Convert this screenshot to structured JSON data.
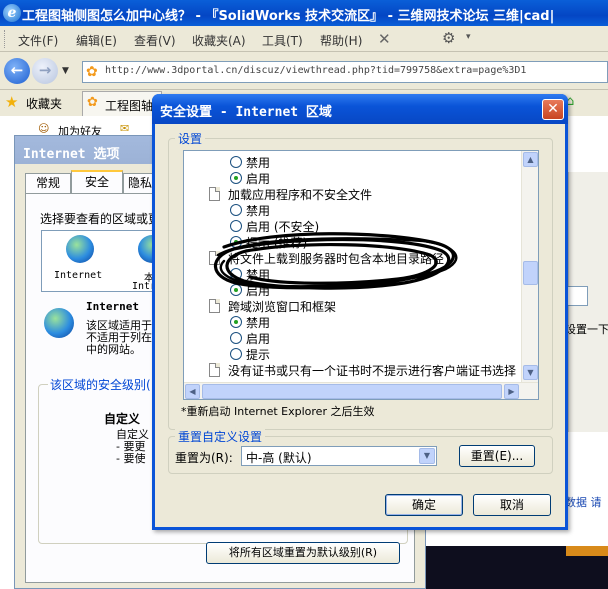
{
  "ie_window": {
    "title": "工程图轴侧图怎么加中心线？ - 『SolidWorks 技术交流区』 - 三维网技术论坛 三维|cad|",
    "menu": [
      "文件(F)",
      "编辑(E)",
      "查看(V)",
      "收藏夹(A)",
      "工具(T)",
      "帮助(H)"
    ],
    "address_url": "http://www.3dportal.cn/discuz/viewthread.php?tid=799758&extra=page%3D1",
    "favorites_label": "收藏夹",
    "tab_label": "工程图轴",
    "page_behind_text": {
      "add_friend": "加为好友",
      "right_text_1": "设置一下",
      "right_text_2": "数据 请"
    }
  },
  "internet_options": {
    "title": "Internet 选项",
    "tabs": [
      "常规",
      "安全",
      "隐私"
    ],
    "zone_prompt": "选择要查看的区域或更",
    "zones": [
      {
        "label": "Internet",
        "icon": "globe-icon"
      },
      {
        "label": "本",
        "icon": "globe-icon"
      }
    ],
    "zones_extra_label": "Intr",
    "zone_heading": "Internet",
    "zone_desc": [
      "该区域适用于",
      "不适用于列在",
      "中的网站。"
    ],
    "security_level_label": "该区域的安全级别(",
    "custom_label": "自定义",
    "custom_lines": [
      "自定义",
      "- 要更",
      "- 要使"
    ],
    "reset_all_button": "将所有区域重置为默认级别(R)"
  },
  "security_dialog": {
    "title": "安全设置 - Internet 区域",
    "close_glyph": "✕",
    "settings_group_label": "设置",
    "settings_items": [
      {
        "kind": "radio",
        "label": "禁用",
        "checked": false
      },
      {
        "kind": "radio",
        "label": "启用",
        "checked": true
      },
      {
        "kind": "header",
        "label": "加载应用程序和不安全文件"
      },
      {
        "kind": "radio",
        "label": "禁用",
        "checked": false
      },
      {
        "kind": "radio",
        "label": "启用 (不安全)",
        "checked": false
      },
      {
        "kind": "radio",
        "label": "提示 (推荐)",
        "checked": true
      },
      {
        "kind": "header",
        "label": "将文件上载到服务器时包含本地目录路径"
      },
      {
        "kind": "radio",
        "label": "禁用",
        "checked": false
      },
      {
        "kind": "radio",
        "label": "启用",
        "checked": true
      },
      {
        "kind": "header",
        "label": "跨域浏览窗口和框架"
      },
      {
        "kind": "radio",
        "label": "禁用",
        "checked": true
      },
      {
        "kind": "radio",
        "label": "启用",
        "checked": false
      },
      {
        "kind": "radio",
        "label": "提示",
        "checked": false
      },
      {
        "kind": "header",
        "label": "没有证书或只有一个证书时不提示进行客户端证书选择"
      }
    ],
    "restart_note": "*重新启动 Internet Explorer 之后生效",
    "reset_group_label": "重置自定义设置",
    "reset_to_label": "重置为(R):",
    "reset_to_value": "中-高 (默认)",
    "reset_button": "重置(E)...",
    "ok_button": "确定",
    "cancel_button": "取消"
  },
  "colors": {
    "xp_blue": "#0a54d8",
    "group_label_blue": "#0046d5",
    "radio_check_green": "#21a121",
    "scribble_black": "#000000"
  }
}
